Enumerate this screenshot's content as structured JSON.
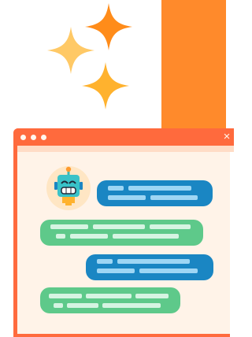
{
  "window": {
    "close_icon": "×"
  },
  "colors": {
    "accent_orange": "#ff8a2b",
    "titlebar": "#ff6a3d",
    "window_bg": "#fff3e8",
    "bubble_blue": "#1a86c3",
    "bubble_green": "#5ec98a",
    "sparkle_orange": "#ff8c1a",
    "sparkle_light": "#ffc966",
    "sparkle_yellow": "#ffb22e"
  },
  "icons": {
    "sparkles": [
      "sparkle-icon",
      "sparkle-icon",
      "sparkle-icon"
    ],
    "avatar": "robot-avatar-icon",
    "close": "close-icon"
  },
  "messages": [
    {
      "sender": "user",
      "type": "placeholder-text"
    },
    {
      "sender": "bot",
      "type": "placeholder-text"
    },
    {
      "sender": "user",
      "type": "placeholder-text"
    },
    {
      "sender": "bot",
      "type": "placeholder-text"
    }
  ]
}
